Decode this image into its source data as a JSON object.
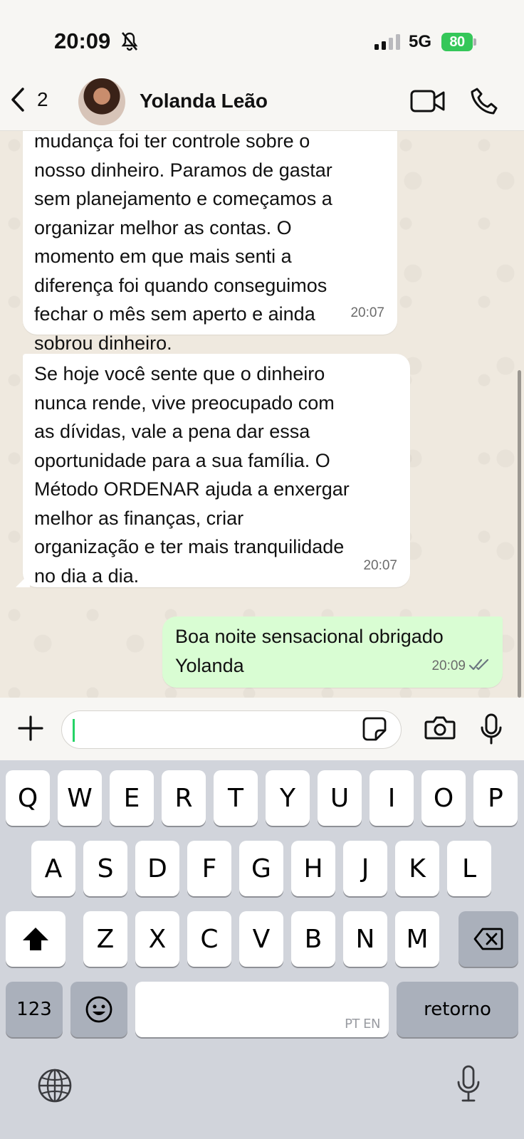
{
  "status_bar": {
    "time": "20:09",
    "network": "5G",
    "battery": "80"
  },
  "header": {
    "back_count": "2",
    "contact_name": "Yolanda Leão"
  },
  "messages": [
    {
      "direction": "incoming",
      "text": "mudança foi ter controle sobre o\nnosso dinheiro. Paramos de gastar\nsem planejamento e começamos a\norganizar melhor as contas. O\nmomento em que mais senti a\ndiferença foi quando conseguimos\nfechar o mês sem aperto e ainda\nsobrou dinheiro.",
      "time": "20:07"
    },
    {
      "direction": "incoming",
      "text": "Se hoje você sente que o dinheiro\nnunca rende, vive preocupado com\nas dívidas, vale a pena dar essa\noportunidade para a sua família. O\nMétodo ORDENAR ajuda a enxergar\nmelhor as finanças, criar\norganização e ter mais tranquilidade\nno dia a dia.",
      "time": "20:07"
    },
    {
      "direction": "outgoing",
      "text": "Boa noite sensacional obrigado\nYolanda",
      "time": "20:09",
      "status": "read"
    }
  ],
  "input": {
    "value": "",
    "placeholder": ""
  },
  "keyboard": {
    "row1": [
      "Q",
      "W",
      "E",
      "R",
      "T",
      "Y",
      "U",
      "I",
      "O",
      "P"
    ],
    "row2": [
      "A",
      "S",
      "D",
      "F",
      "G",
      "H",
      "J",
      "K",
      "L"
    ],
    "row3": [
      "Z",
      "X",
      "C",
      "V",
      "B",
      "N",
      "M"
    ],
    "numbers_key": "123",
    "space_hint": "PT EN",
    "return_key": "retorno"
  },
  "colors": {
    "outgoing_bubble": "#d9fdd3",
    "incoming_bubble": "#ffffff",
    "battery": "#35c759",
    "read_ticks": "#53bdeb",
    "caret": "#25d366"
  }
}
